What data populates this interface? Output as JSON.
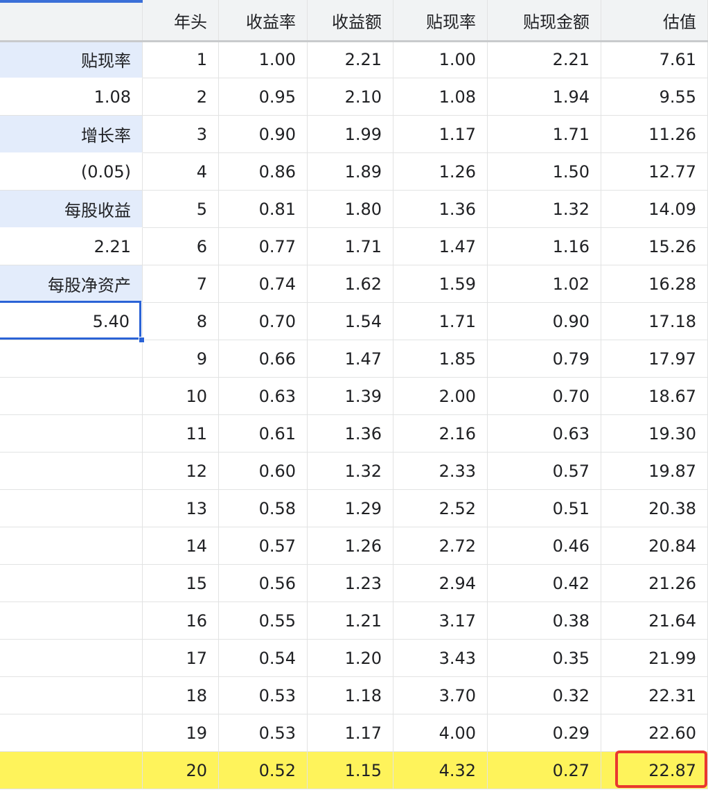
{
  "columns": [
    "",
    "年头",
    "收益率",
    "收益额",
    "贴现率",
    "贴现金额",
    "估值"
  ],
  "params": [
    {
      "label": "贴现率",
      "value": "1.08"
    },
    {
      "label": "增长率",
      "value": "(0.05)"
    },
    {
      "label": "每股收益",
      "value": "2.21"
    },
    {
      "label": "每股净资产",
      "value": "5.40"
    }
  ],
  "rows": [
    [
      "1",
      "1.00",
      "2.21",
      "1.00",
      "2.21",
      "7.61"
    ],
    [
      "2",
      "0.95",
      "2.10",
      "1.08",
      "1.94",
      "9.55"
    ],
    [
      "3",
      "0.90",
      "1.99",
      "1.17",
      "1.71",
      "11.26"
    ],
    [
      "4",
      "0.86",
      "1.89",
      "1.26",
      "1.50",
      "12.77"
    ],
    [
      "5",
      "0.81",
      "1.80",
      "1.36",
      "1.32",
      "14.09"
    ],
    [
      "6",
      "0.77",
      "1.71",
      "1.47",
      "1.16",
      "15.26"
    ],
    [
      "7",
      "0.74",
      "1.62",
      "1.59",
      "1.02",
      "16.28"
    ],
    [
      "8",
      "0.70",
      "1.54",
      "1.71",
      "0.90",
      "17.18"
    ],
    [
      "9",
      "0.66",
      "1.47",
      "1.85",
      "0.79",
      "17.97"
    ],
    [
      "10",
      "0.63",
      "1.39",
      "2.00",
      "0.70",
      "18.67"
    ],
    [
      "11",
      "0.61",
      "1.36",
      "2.16",
      "0.63",
      "19.30"
    ],
    [
      "12",
      "0.60",
      "1.32",
      "2.33",
      "0.57",
      "19.87"
    ],
    [
      "13",
      "0.58",
      "1.29",
      "2.52",
      "0.51",
      "20.38"
    ],
    [
      "14",
      "0.57",
      "1.26",
      "2.72",
      "0.46",
      "20.84"
    ],
    [
      "15",
      "0.56",
      "1.23",
      "2.94",
      "0.42",
      "21.26"
    ],
    [
      "16",
      "0.55",
      "1.21",
      "3.17",
      "0.38",
      "21.64"
    ],
    [
      "17",
      "0.54",
      "1.20",
      "3.43",
      "0.35",
      "21.99"
    ],
    [
      "18",
      "0.53",
      "1.18",
      "3.70",
      "0.32",
      "22.31"
    ],
    [
      "19",
      "0.53",
      "1.17",
      "4.00",
      "0.29",
      "22.60"
    ],
    [
      "20",
      "0.52",
      "1.15",
      "4.32",
      "0.27",
      "22.87"
    ]
  ],
  "selected_param_index": 3,
  "highlighted_row_index": 19,
  "emphasized_cell": {
    "row_index": 19,
    "column": "估值"
  },
  "colors": {
    "header_bg": "#f1f3f4",
    "label_bg": "#e3ecfb",
    "selection": "#2b63d6",
    "row_highlight": "#fef35b",
    "emphasis_outline": "#e9382f",
    "grid": "#e2e3e3"
  }
}
